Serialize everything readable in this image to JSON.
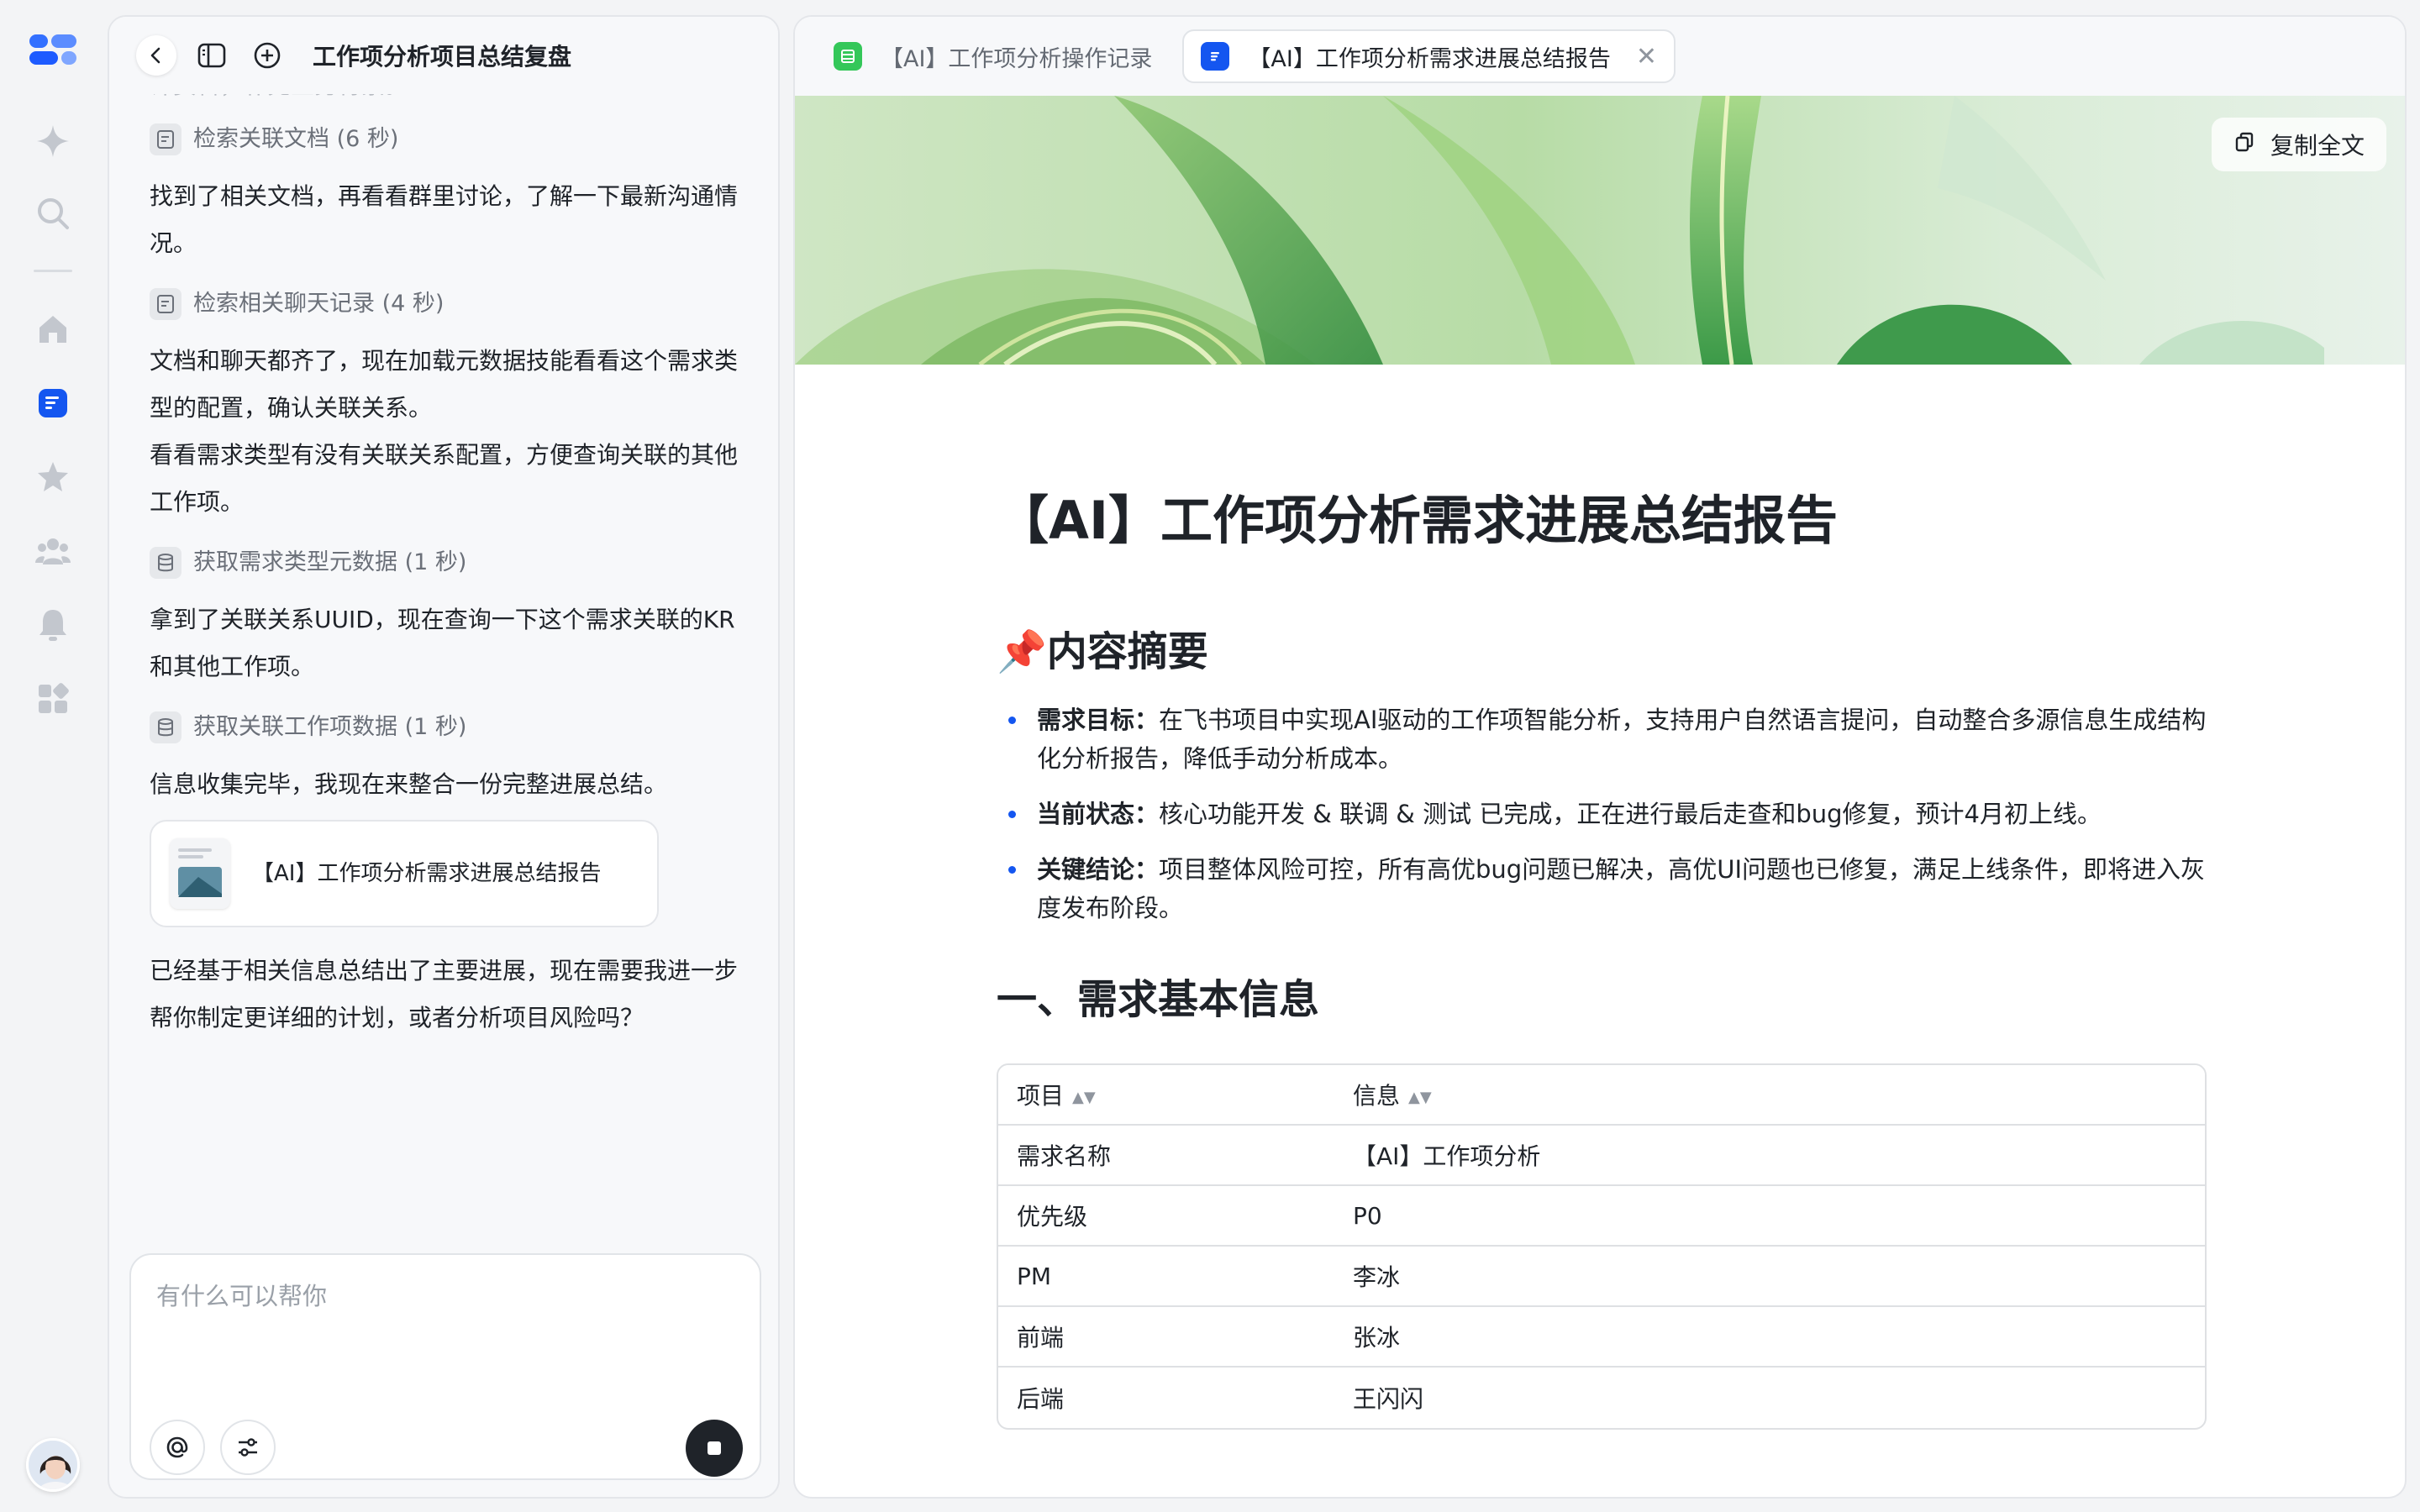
{
  "rail": {
    "icons": [
      "app-logo-icon",
      "sparkle-icon",
      "search-icon",
      "home-icon",
      "docs-icon",
      "star-icon",
      "team-icon",
      "bell-icon",
      "apps-icon"
    ]
  },
  "chat": {
    "title": "工作项分析项目总结复盘",
    "faded_text": "计资料，补充业务背景。",
    "steps": [
      {
        "type": "tool",
        "icon": "doc-icon",
        "text": "检索关联文档 (6 秒)"
      },
      {
        "type": "text",
        "text": "找到了相关文档，再看看群里讨论，了解一下最新沟通情况。"
      },
      {
        "type": "tool",
        "icon": "doc-icon",
        "text": "检索相关聊天记录 (4 秒)"
      },
      {
        "type": "text",
        "text": "文档和聊天都齐了，现在加载元数据技能看看这个需求类型的配置，确认关联关系。"
      },
      {
        "type": "text",
        "text": "看看需求类型有没有关联关系配置，方便查询关联的其他工作项。"
      },
      {
        "type": "tool",
        "icon": "database-icon",
        "text": "获取需求类型元数据 (1 秒)"
      },
      {
        "type": "text",
        "text": "拿到了关联关系UUID，现在查询一下这个需求关联的KR和其他工作项。"
      },
      {
        "type": "tool",
        "icon": "database-icon",
        "text": "获取关联工作项数据 (1 秒)"
      },
      {
        "type": "text",
        "text": "信息收集完毕，我现在来整合一份完整进展总结。"
      }
    ],
    "card_title": "【AI】工作项分析需求进展总结报告",
    "final_text": "已经基于相关信息总结出了主要进展，现在需要我进一步帮你制定更详细的计划，或者分析项目风险吗？",
    "composer_placeholder": "有什么可以帮你"
  },
  "tabs": [
    {
      "label": "【AI】工作项分析操作记录",
      "icon": "sheet-icon",
      "color": "#34c759",
      "active": false
    },
    {
      "label": "【AI】工作项分析需求进展总结报告",
      "icon": "doc-icon",
      "color": "#1456f0",
      "active": true
    }
  ],
  "doc": {
    "copy_label": "复制全文",
    "title": "【AI】工作项分析需求进展总结报告",
    "summary_heading": "📌内容摘要",
    "bullets": [
      {
        "label": "需求目标：",
        "text": "在飞书项目中实现AI驱动的工作项智能分析，支持用户自然语言提问，自动整合多源信息生成结构化分析报告，降低手动分析成本。"
      },
      {
        "label": "当前状态：",
        "text": "核心功能开发 & 联调 & 测试 已完成，正在进行最后走查和bug修复，预计4月初上线。"
      },
      {
        "label": "关键结论：",
        "text": "项目整体风险可控，所有高优bug问题已解决，高优UI问题也已修复，满足上线条件，即将进入灰度发布阶段。"
      }
    ],
    "section1_heading": "一、需求基本信息",
    "table": {
      "headers": [
        "项目",
        "信息"
      ],
      "rows": [
        [
          "需求名称",
          "【AI】工作项分析"
        ],
        [
          "优先级",
          "P0"
        ],
        [
          "PM",
          "李冰"
        ],
        [
          "前端",
          "张冰"
        ],
        [
          "后端",
          "王闪闪"
        ]
      ]
    }
  },
  "colors": {
    "accent": "#1456f0",
    "bullet": "#1456f0",
    "stop_button": "#1f2329"
  }
}
